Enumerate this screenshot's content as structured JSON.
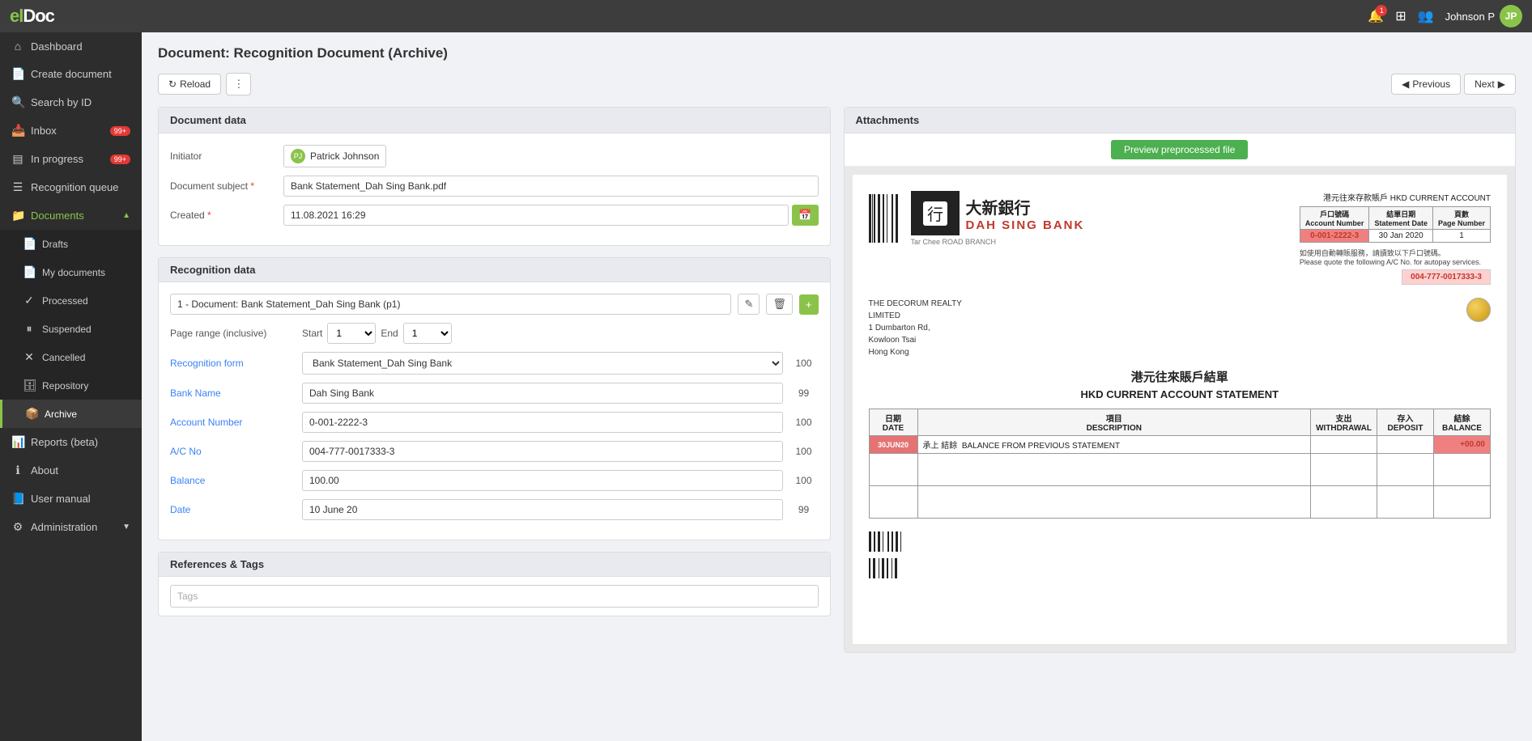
{
  "app": {
    "name_prefix": "el",
    "name_suffix": "Doc"
  },
  "topnav": {
    "user_name": "Johnson P",
    "notification_icon": "🔔",
    "grid_icon": "⊞",
    "users_icon": "👥"
  },
  "sidebar": {
    "collapse_icon": "‹",
    "items": [
      {
        "label": "Dashboard",
        "icon": "⌂",
        "id": "dashboard"
      },
      {
        "label": "Create document",
        "icon": "📄",
        "id": "create-document"
      },
      {
        "label": "Search by ID",
        "icon": "🔍",
        "id": "search-by-id"
      },
      {
        "label": "Inbox",
        "icon": "📥",
        "id": "inbox",
        "badge": "99+"
      },
      {
        "label": "In progress",
        "icon": "▤",
        "id": "in-progress",
        "badge": "99+"
      },
      {
        "label": "Recognition queue",
        "icon": "☰",
        "id": "recognition-queue"
      },
      {
        "label": "Documents",
        "icon": "📁",
        "id": "documents",
        "expanded": true,
        "chevron": "▲"
      },
      {
        "label": "Drafts",
        "icon": "📄",
        "id": "drafts",
        "sub": true
      },
      {
        "label": "My documents",
        "icon": "📄",
        "id": "my-documents",
        "sub": true
      },
      {
        "label": "Processed",
        "icon": "✓",
        "id": "processed",
        "sub": true
      },
      {
        "label": "Suspended",
        "icon": "⏸",
        "id": "suspended",
        "sub": true
      },
      {
        "label": "Cancelled",
        "icon": "✕",
        "id": "cancelled",
        "sub": true
      },
      {
        "label": "Repository",
        "icon": "🗄",
        "id": "repository",
        "sub": true
      },
      {
        "label": "Archive",
        "icon": "📦",
        "id": "archive",
        "sub": true,
        "active": true
      },
      {
        "label": "Reports (beta)",
        "icon": "📊",
        "id": "reports"
      },
      {
        "label": "About",
        "icon": "ℹ",
        "id": "about"
      },
      {
        "label": "User manual",
        "icon": "📘",
        "id": "user-manual"
      },
      {
        "label": "Administration",
        "icon": "⚙",
        "id": "administration",
        "chevron": "▼"
      }
    ]
  },
  "page": {
    "title": "Document: Recognition Document (Archive)"
  },
  "toolbar": {
    "reload_label": "Reload",
    "reload_icon": "↻",
    "more_icon": "⋮",
    "previous_label": "Previous",
    "next_label": "Next",
    "prev_icon": "◀",
    "next_icon": "▶"
  },
  "document_data": {
    "section_title": "Document data",
    "initiator_label": "Initiator",
    "initiator_name": "Patrick Johnson",
    "document_subject_label": "Document subject",
    "document_subject_required": true,
    "document_subject_value": "Bank Statement_Dah Sing Bank.pdf",
    "created_label": "Created",
    "created_required": true,
    "created_value": "11.08.2021 16:29",
    "calendar_icon": "📅"
  },
  "recognition_data": {
    "section_title": "Recognition data",
    "dropdown_value": "1 - Document: Bank Statement_Dah Sing Bank (p1)",
    "edit_icon": "✎",
    "delete_icon": "🗑",
    "add_icon": "+",
    "page_range_label": "Page range (inclusive)",
    "page_start_label": "Start",
    "page_start_value": "1",
    "page_end_label": "End",
    "page_end_value": "1",
    "recognition_form_label": "Recognition form",
    "recognition_form_value": "Bank Statement_Dah Sing Bank",
    "recognition_form_score": "100",
    "bank_name_label": "Bank Name",
    "bank_name_value": "Dah Sing Bank",
    "bank_name_score": "99",
    "account_number_label": "Account Number",
    "account_number_value": "0-001-2222-3",
    "account_number_score": "100",
    "ac_no_label": "A/C No",
    "ac_no_value": "004-777-0017333-3",
    "ac_no_score": "100",
    "balance_label": "Balance",
    "balance_value": "100.00",
    "balance_score": "100",
    "date_label": "Date",
    "date_value": "10 June 20",
    "date_score": "99"
  },
  "references": {
    "section_title": "References & Tags",
    "tags_placeholder": "Tags"
  },
  "attachments": {
    "section_title": "Attachments",
    "preview_button": "Preview preprocessed file"
  },
  "bank_document": {
    "name_zh": "大新銀行",
    "name_en": "DAH SING BANK",
    "branch": "Tar Chee ROAD    BRANCH",
    "account_type": "港元往來存款賬戶 HKD CURRENT ACCOUNT",
    "col1": "戶口號碼\nAccount Number",
    "col2": "結單日期\nStatement Date",
    "col3": "頁數\nPage Number",
    "account_number": "0-001-2222-3",
    "statement_date": "30 Jan 2020",
    "page_number": "1",
    "address_line1": "THE DECORUM REALTY",
    "address_line2": "LIMITED",
    "address_line3": "1 Dumbarton Rd,",
    "address_line4": "Kowloon Tsai",
    "address_line5": "Hong Kong",
    "ac_no": "004-777-0017333-3",
    "title_zh": "港元往來賬戶結單",
    "title_en": "HKD CURRENT ACCOUNT STATEMENT",
    "table_headers": [
      "日期\nDATE",
      "項目\nDESCRIPTION",
      "支出\nWITHDRAWAL",
      "存入\nDEPOSIT",
      "結餘\nBALANCE"
    ],
    "row_date": "30JUN20",
    "row_desc_zh": "承上 結餘",
    "row_desc_en": "BALANCE FROM PREVIOUS STATEMENT",
    "row_balance": "+00.00"
  }
}
